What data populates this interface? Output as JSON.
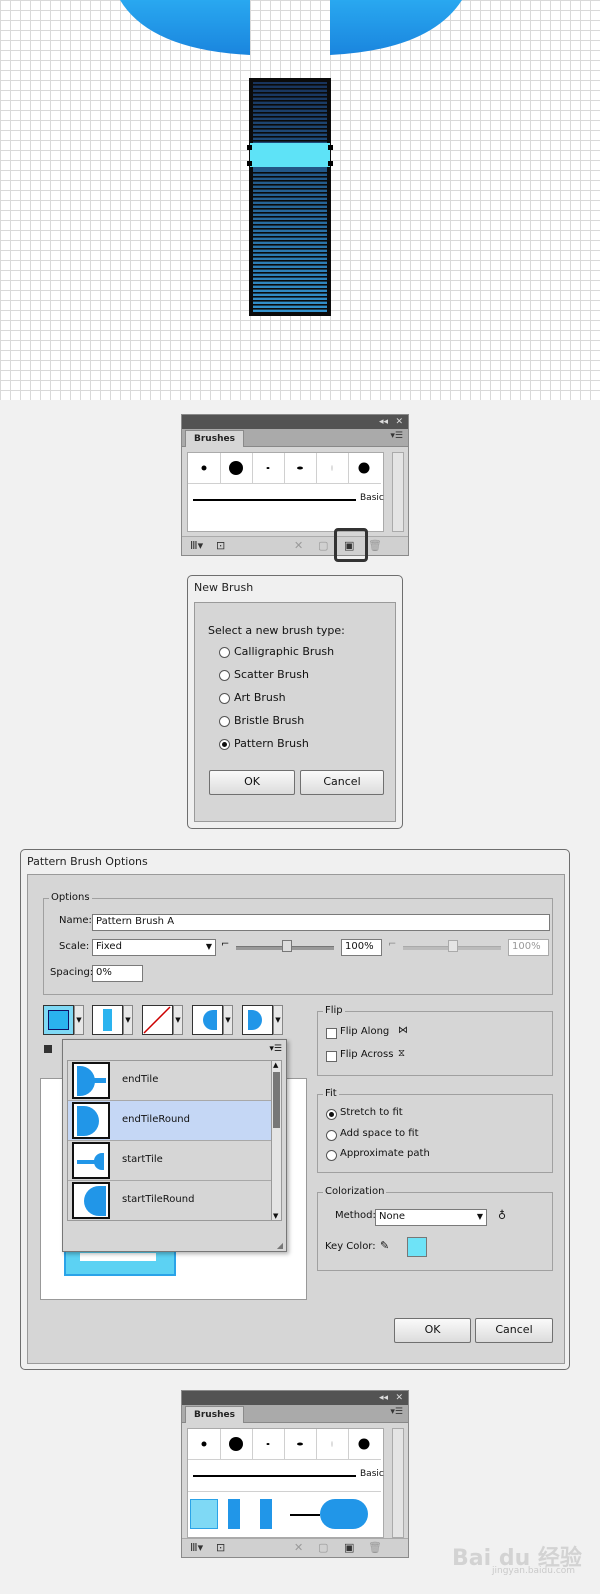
{
  "brushes_panel_top": {
    "tab_label": "Brushes",
    "basic_label": "Basic"
  },
  "new_brush_dialog": {
    "title": "New Brush",
    "prompt": "Select a new brush type:",
    "options": [
      "Calligraphic Brush",
      "Scatter Brush",
      "Art Brush",
      "Bristle Brush",
      "Pattern Brush"
    ],
    "selected": "Pattern Brush",
    "ok_label": "OK",
    "cancel_label": "Cancel"
  },
  "pattern_brush_dialog": {
    "title": "Pattern Brush Options",
    "options_group": "Options",
    "name_label": "Name:",
    "name_value": "Pattern Brush A",
    "scale_label": "Scale:",
    "scale_value": "Fixed",
    "scale_percent": "100%",
    "scale_percent_disabled": "100%",
    "spacing_label": "Spacing:",
    "spacing_value": "0%",
    "tile_list": [
      "endTile",
      "endTileRound",
      "startTile",
      "startTileRound"
    ],
    "tile_list_selected": "endTileRound",
    "flip_group": "Flip",
    "flip_along": "Flip Along",
    "flip_across": "Flip Across",
    "fit_group": "Fit",
    "fit_options": [
      "Stretch to fit",
      "Add space to fit",
      "Approximate path"
    ],
    "fit_selected": "Stretch to fit",
    "colorization_group": "Colorization",
    "method_label": "Method:",
    "method_value": "None",
    "key_color_label": "Key Color:",
    "key_color": "#6ee3f7",
    "ok_label": "OK",
    "cancel_label": "Cancel"
  },
  "brushes_panel_bottom": {
    "tab_label": "Brushes",
    "basic_label": "Basic"
  },
  "watermark": {
    "text": "Bai du 经验",
    "url": "jingyan.baidu.com"
  },
  "colors": {
    "accent_blue": "#2196e8",
    "light_blue": "#5ee3f7",
    "selection": "#c5d7f5"
  }
}
